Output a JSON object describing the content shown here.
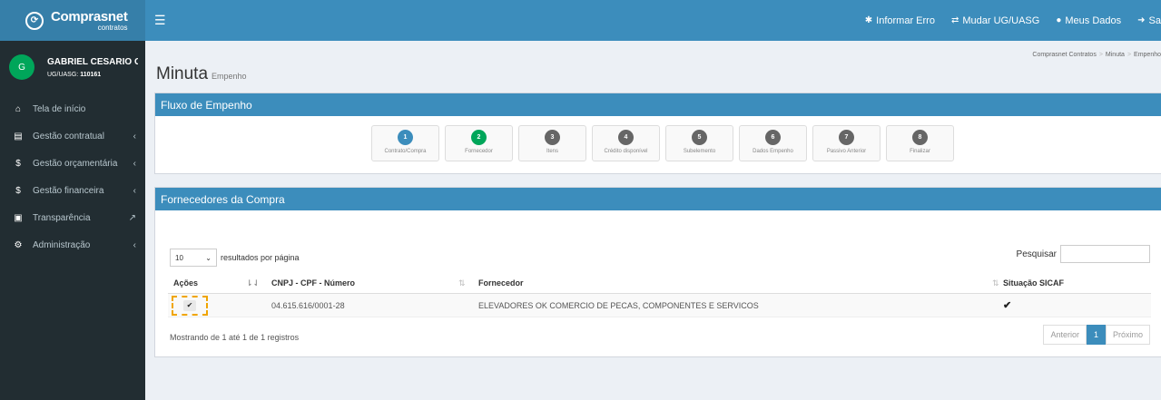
{
  "header": {
    "logo_main": "Comprasnet",
    "logo_sub": "contratos",
    "nav": [
      {
        "icon": "bug-icon",
        "label": "Informar Erro"
      },
      {
        "icon": "exchange-icon",
        "label": "Mudar UG/UASG"
      },
      {
        "icon": "user-circle-icon",
        "label": "Meus Dados"
      },
      {
        "icon": "sign-out-icon",
        "label": "Sa"
      }
    ]
  },
  "sidebar": {
    "avatar_initial": "G",
    "user_name": "GABRIEL CESARIO GUI...",
    "uasg_label": "UG/UASG:",
    "uasg_value": "110161",
    "items": [
      {
        "icon": "home-icon",
        "label": "Tela de início"
      },
      {
        "icon": "file-icon",
        "label": "Gestão contratual"
      },
      {
        "icon": "dollar-icon",
        "label": "Gestão orçamentária"
      },
      {
        "icon": "dollar-icon",
        "label": "Gestão financeira"
      },
      {
        "icon": "id-card-icon",
        "label": "Transparência"
      },
      {
        "icon": "cogs-icon",
        "label": "Administração"
      }
    ]
  },
  "page": {
    "title": "Minuta",
    "subtitle": "Empenho",
    "breadcrumb": [
      "Comprasnet Contratos",
      "Minuta",
      "Empenho"
    ]
  },
  "flow": {
    "title": "Fluxo de Empenho",
    "steps": [
      {
        "num": "1",
        "label": "Contrato/Compra",
        "state": "active"
      },
      {
        "num": "2",
        "label": "Fornecedor",
        "state": "done"
      },
      {
        "num": "3",
        "label": "Itens",
        "state": "pending"
      },
      {
        "num": "4",
        "label": "Crédito disponível",
        "state": "pending"
      },
      {
        "num": "5",
        "label": "Subelemento",
        "state": "pending"
      },
      {
        "num": "6",
        "label": "Dados Empenho",
        "state": "pending"
      },
      {
        "num": "7",
        "label": "Passivo Anterior",
        "state": "pending"
      },
      {
        "num": "8",
        "label": "Finalizar",
        "state": "pending"
      }
    ]
  },
  "suppliers": {
    "title": "Fornecedores da Compra",
    "page_length": "10",
    "page_length_suffix": "resultados por página",
    "search_label": "Pesquisar",
    "columns": [
      "Ações",
      "CNPJ - CPF - Número",
      "Fornecedor",
      "Situação SICAF"
    ],
    "rows": [
      {
        "cnpj": "04.615.616/0001-28",
        "fornecedor": "ELEVADORES OK COMERCIO DE PECAS, COMPONENTES E SERVICOS",
        "sicaf": "✔"
      }
    ],
    "showing": "Mostrando de 1 até 1 de 1 registros",
    "pagination": {
      "prev": "Anterior",
      "current": "1",
      "next": "Próximo"
    }
  }
}
